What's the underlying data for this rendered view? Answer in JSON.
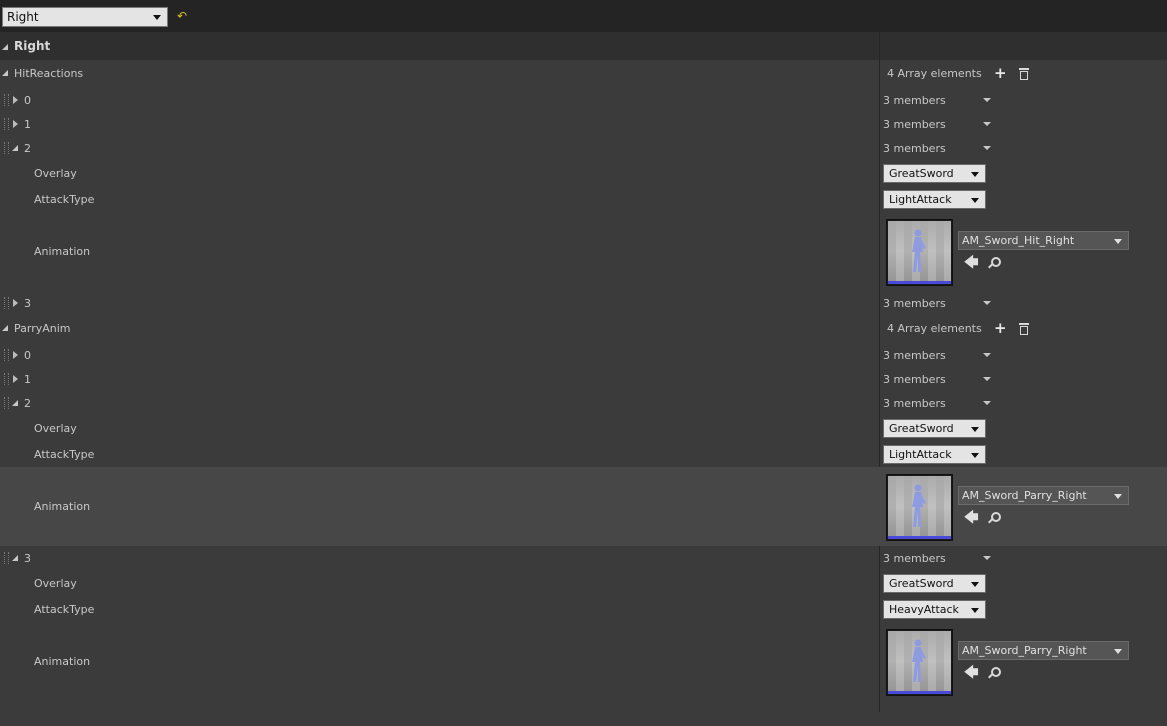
{
  "top_dropdown": {
    "value": "Right"
  },
  "category": {
    "title": "Right"
  },
  "groups": [
    {
      "name": "HitReactions",
      "count_label": "4 Array elements",
      "elements": [
        {
          "index": "0",
          "summary": "3 members",
          "expanded": false
        },
        {
          "index": "1",
          "summary": "3 members",
          "expanded": false
        },
        {
          "index": "2",
          "summary": "3 members",
          "expanded": true,
          "overlay_label": "Overlay",
          "overlay": "GreatSword",
          "attack_label": "AttackType",
          "attack": "LightAttack",
          "anim_label": "Animation",
          "anim": "AM_Sword_Hit_Right"
        },
        {
          "index": "3",
          "summary": "3 members",
          "expanded": false
        }
      ]
    },
    {
      "name": "ParryAnim",
      "count_label": "4 Array elements",
      "elements": [
        {
          "index": "0",
          "summary": "3 members",
          "expanded": false
        },
        {
          "index": "1",
          "summary": "3 members",
          "expanded": false
        },
        {
          "index": "2",
          "summary": "3 members",
          "expanded": true,
          "overlay_label": "Overlay",
          "overlay": "GreatSword",
          "attack_label": "AttackType",
          "attack": "LightAttack",
          "anim_label": "Animation",
          "anim": "AM_Sword_Parry_Right"
        },
        {
          "index": "3",
          "summary": "3 members",
          "expanded": true,
          "overlay_label": "Overlay",
          "overlay": "GreatSword",
          "attack_label": "AttackType",
          "attack": "HeavyAttack",
          "anim_label": "Animation",
          "anim": "AM_Sword_Parry_Right"
        }
      ]
    }
  ],
  "icons": {
    "reset": "reset-to-default-icon",
    "add": "plus-icon",
    "delete": "trash-icon",
    "browse_back": "use-selected-arrow-icon",
    "find": "magnifier-icon"
  }
}
